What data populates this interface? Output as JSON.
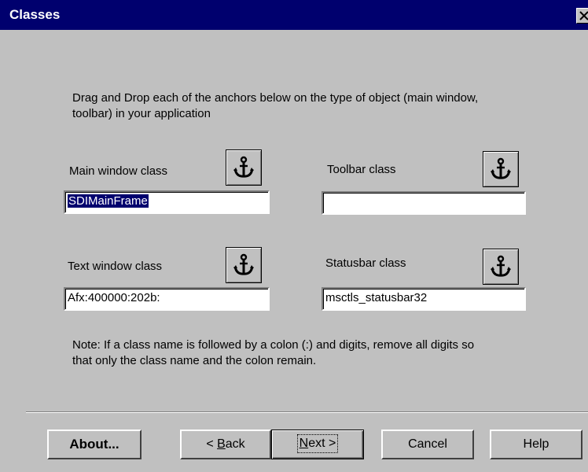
{
  "window": {
    "title": "Classes",
    "close_glyph": "close-x-icon"
  },
  "instruction": {
    "line1": "Drag and Drop each of the anchors below on the type of object (main window,",
    "line2": "toolbar) in your application"
  },
  "fields": {
    "main_window": {
      "label": "Main window class",
      "value": "SDIMainFrame",
      "selected": true,
      "icon": "anchor-icon"
    },
    "toolbar": {
      "label": "Toolbar class",
      "value": "",
      "icon": "anchor-icon"
    },
    "text_window": {
      "label": "Text window class",
      "value": "Afx:400000:202b:",
      "icon": "anchor-icon"
    },
    "statusbar": {
      "label": "Statusbar class",
      "value": "msctls_statusbar32",
      "icon": "anchor-icon"
    }
  },
  "note": {
    "line1": "Note: If a class name is followed by a colon (:) and digits, remove all digits so",
    "line2": "that only the class name and the colon remain."
  },
  "buttons": {
    "about": "About...",
    "back_prefix": "< ",
    "back_mnemonic": "B",
    "back_rest": "ack",
    "next_mnemonic": "N",
    "next_rest": "ext >",
    "cancel": "Cancel",
    "help": "Help"
  },
  "colors": {
    "titlebar": "#00006e",
    "face": "#c0c0c0",
    "selection": "#00006e"
  }
}
